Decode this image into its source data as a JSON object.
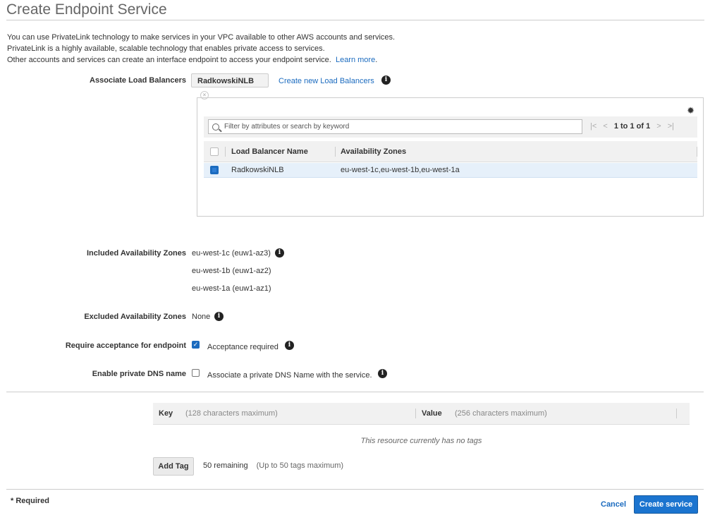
{
  "page": {
    "title": "Create Endpoint Service",
    "intro_lines": [
      "You can use PrivateLink technology to make services in your VPC available to other AWS accounts and services.",
      "PrivateLink is a highly available, scalable technology that enables private access to services.",
      "Other accounts and services can create an interface endpoint to access your endpoint service."
    ],
    "learn_more": "Learn more",
    "learn_more_suffix": "."
  },
  "load_balancers": {
    "label": "Associate Load Balancers",
    "selected_chip": "RadkowskiNLB",
    "create_link": "Create new Load Balancers",
    "filter_placeholder": "Filter by attributes or search by keyword",
    "pager_text": "1 to 1 of 1",
    "columns": [
      "Load Balancer Name",
      "Availability Zones"
    ],
    "rows": [
      {
        "name": "RadkowskiNLB",
        "zones": "eu-west-1c,eu-west-1b,eu-west-1a",
        "selected": true
      }
    ]
  },
  "zones": {
    "included_label": "Included Availability Zones",
    "included": [
      "eu-west-1c (euw1-az3)",
      "eu-west-1b (euw1-az2)",
      "eu-west-1a (euw1-az1)"
    ],
    "excluded_label": "Excluded Availability Zones",
    "excluded_value": "None"
  },
  "acceptance": {
    "label": "Require acceptance for endpoint",
    "checked": true,
    "text": "Acceptance required"
  },
  "private_dns": {
    "label": "Enable private DNS name",
    "checked": false,
    "text": "Associate a private DNS Name with the service."
  },
  "tags": {
    "key_label": "Key",
    "key_hint": "(128 characters maximum)",
    "value_label": "Value",
    "value_hint": "(256 characters maximum)",
    "empty_text": "This resource currently has no tags",
    "add_button": "Add Tag",
    "remaining": "50 remaining",
    "limit_hint": "(Up to 50 tags maximum)"
  },
  "footer": {
    "required_note": "* Required",
    "cancel": "Cancel",
    "submit": "Create service"
  },
  "colors": {
    "accent": "#1b74cf",
    "link": "#1b6bbf",
    "row_selected": "#e6f0fa"
  }
}
